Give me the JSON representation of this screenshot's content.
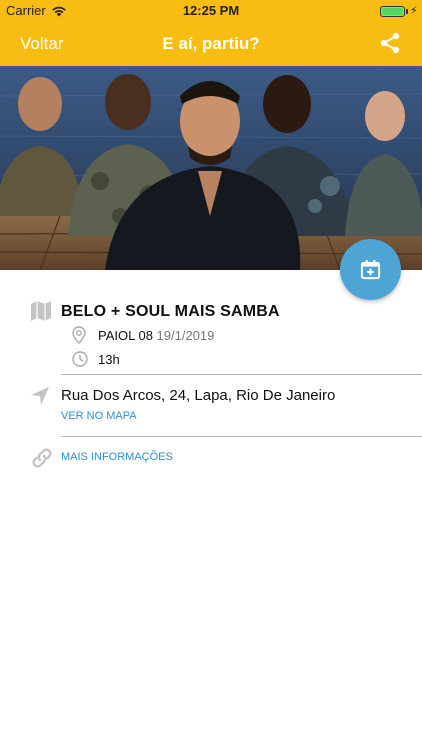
{
  "status_bar": {
    "carrier": "Carrier",
    "time": "12:25 PM",
    "battery_level": 1.0
  },
  "nav": {
    "back_label": "Voltar",
    "title": "E aí, partiu?",
    "share_icon": "share-icon"
  },
  "event": {
    "title": "BELO + SOUL MAIS SAMBA",
    "venue": "PAIOL 08",
    "date": "19/1/2019",
    "time": "13h",
    "address": "Rua Dos Arcos, 24, Lapa, Rio De Janeiro",
    "map_link": "VER NO MAPA",
    "info_link": "MAIS INFORMAÇÕES"
  },
  "colors": {
    "accent": "#f8bd12",
    "fab": "#4fa4d6",
    "link": "#2d8ed6"
  },
  "icons": [
    "map-icon",
    "pin-icon",
    "clock-icon",
    "navigation-arrow-icon",
    "link-icon",
    "calendar-add-icon"
  ]
}
